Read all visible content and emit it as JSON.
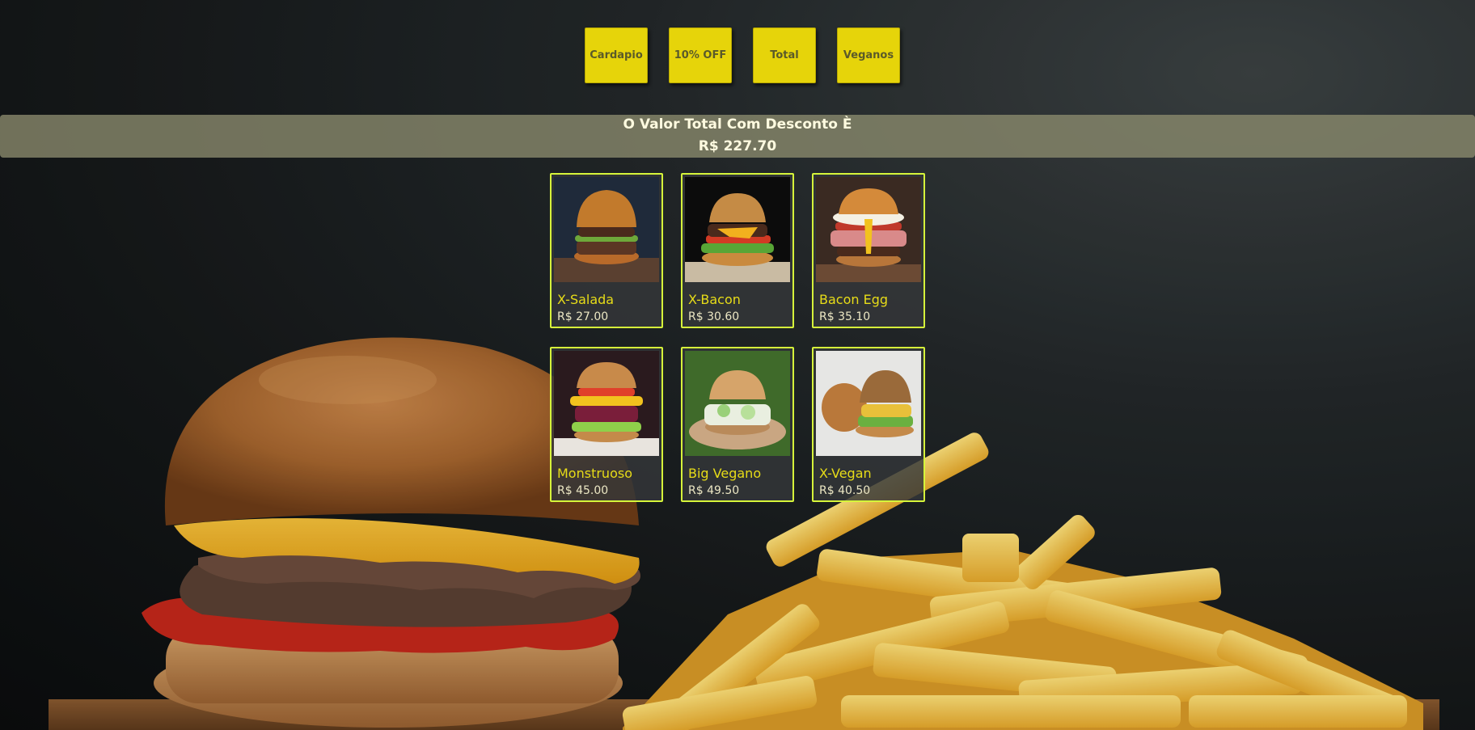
{
  "nav": {
    "buttons": [
      {
        "label": "Cardapio"
      },
      {
        "label": "10% OFF"
      },
      {
        "label": "Total"
      },
      {
        "label": "Veganos"
      }
    ]
  },
  "total_banner": {
    "title": "O Valor Total Com Desconto È",
    "value": "R$ 227.70"
  },
  "products": [
    {
      "name": "X-Salada",
      "price": "R$ 27.00",
      "icon": "burger-photo"
    },
    {
      "name": "X-Bacon",
      "price": "R$ 30.60",
      "icon": "burger-photo"
    },
    {
      "name": "Bacon Egg",
      "price": "R$ 35.10",
      "icon": "burger-photo"
    },
    {
      "name": "Monstruoso",
      "price": "R$ 45.00",
      "icon": "burger-photo"
    },
    {
      "name": "Big Vegano",
      "price": "R$ 49.50",
      "icon": "burger-photo"
    },
    {
      "name": "X-Vegan",
      "price": "R$ 40.50",
      "icon": "burger-photo"
    }
  ],
  "colors": {
    "button_bg": "#e6d40a",
    "card_border": "#d6f53a",
    "product_name": "#e7dc18",
    "banner_bg": "#8c8c6e"
  }
}
